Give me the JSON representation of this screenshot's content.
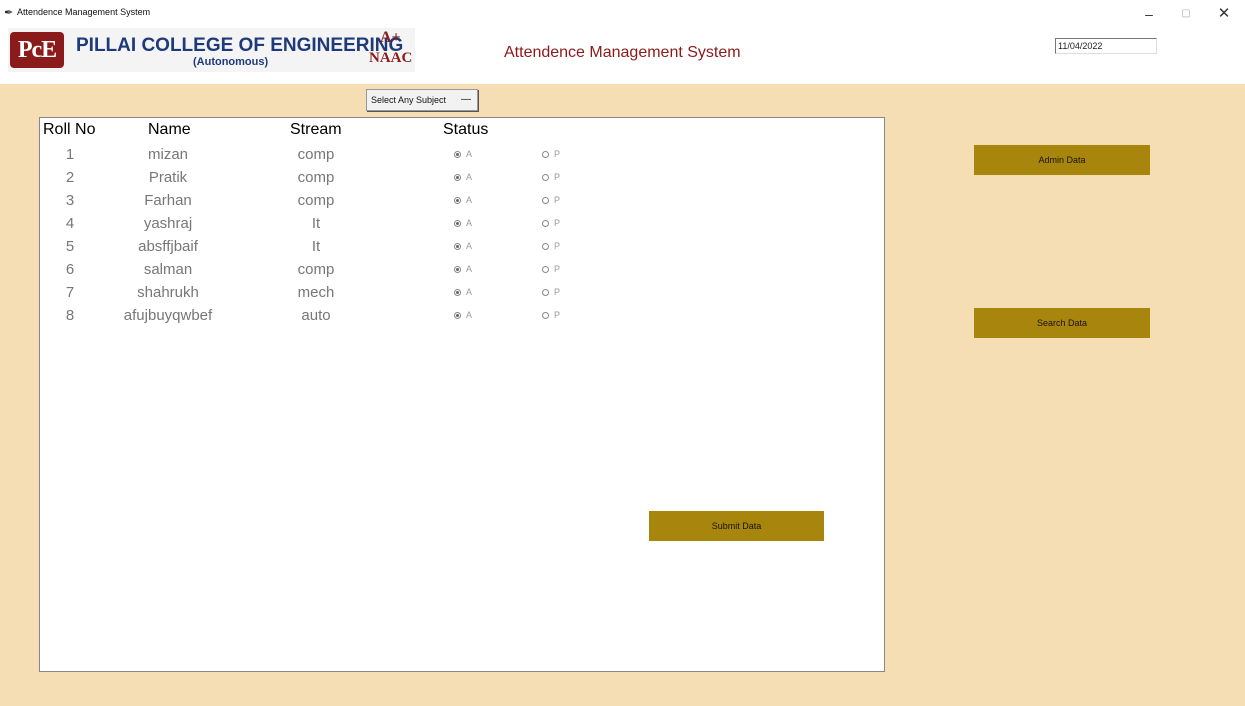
{
  "window": {
    "title": "Attendence Management System",
    "controls": {
      "minimize": "–",
      "maximize": "▢",
      "close": "✕"
    },
    "icon": "feather-icon"
  },
  "header": {
    "logo": {
      "mark": "PcE",
      "name": "PILLAI COLLEGE OF ENGINEERING",
      "subtitle": "(Autonomous)",
      "grade": "A+",
      "accreditation": "NAAC"
    },
    "app_title": "Attendence Management System",
    "date": "11/04/2022"
  },
  "subject_select": {
    "selected": "Select Any Subject"
  },
  "table": {
    "headers": {
      "roll": "Roll No",
      "name": "Name",
      "stream": "Stream",
      "status": "Status"
    },
    "rows": [
      {
        "roll": "1",
        "name": "mizan",
        "stream": "comp",
        "status": "A"
      },
      {
        "roll": "2",
        "name": "Pratik",
        "stream": "comp",
        "status": "A"
      },
      {
        "roll": "3",
        "name": "Farhan",
        "stream": "comp",
        "status": "A"
      },
      {
        "roll": "4",
        "name": "yashraj",
        "stream": "It",
        "status": "A"
      },
      {
        "roll": "5",
        "name": "absffjbaif",
        "stream": "It",
        "status": "A"
      },
      {
        "roll": "6",
        "name": "salman",
        "stream": "comp",
        "status": "A"
      },
      {
        "roll": "7",
        "name": "shahrukh",
        "stream": "mech",
        "status": "A"
      },
      {
        "roll": "8",
        "name": "afujbuyqwbef",
        "stream": "auto",
        "status": "A"
      }
    ],
    "options": {
      "absent": "A",
      "present": "P"
    }
  },
  "buttons": {
    "submit": "Submit Data",
    "admin": "Admin Data",
    "search": "Search Data"
  },
  "colors": {
    "background": "#f5deb3",
    "button": "#a8860e",
    "title": "#8b1a1a",
    "logo_text": "#1f3a7a"
  }
}
